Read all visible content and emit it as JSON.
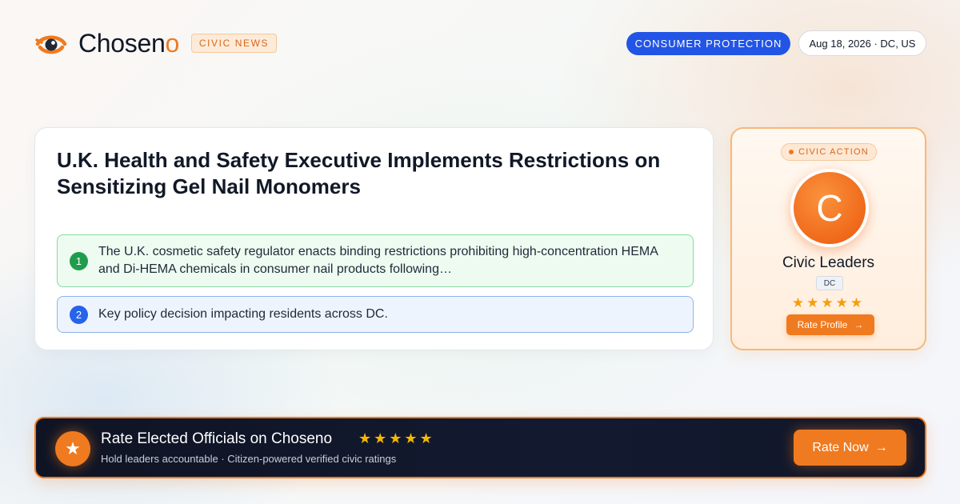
{
  "brand": {
    "name_main": "Chosen",
    "name_accent": "o",
    "accent_color": "#f07a1f"
  },
  "header": {
    "tag": "CIVIC NEWS",
    "category": "CONSUMER PROTECTION",
    "date_location": "Aug 18, 2026 · DC, US"
  },
  "article": {
    "headline": "U.K. Health and Safety Executive Implements Restrictions on Sensitizing Gel Nail Monomers",
    "points": [
      {
        "number": "1",
        "text": "The U.K. cosmetic safety regulator enacts binding restrictions prohibiting high-concentration HEMA and Di-HEMA chemicals in consumer nail products following…"
      },
      {
        "number": "2",
        "text": "Key policy decision impacting residents across DC."
      }
    ]
  },
  "civic_action": {
    "tag": "CIVIC ACTION",
    "avatar_initial": "C",
    "name": "Civic Leaders",
    "state": "DC",
    "stars": "★★★★★",
    "button_label": "Rate Profile",
    "button_arrow": "→"
  },
  "banner": {
    "icon": "★",
    "title": "Rate Elected Officials on Choseno",
    "stars": "★★★★★",
    "subtitle": "Hold leaders accountable · Citizen-powered verified civic ratings",
    "button_label": "Rate Now",
    "button_arrow": "→"
  },
  "icons": {
    "logo": "eye-logo-icon",
    "banner_badge": "star-icon",
    "arrow": "arrow-right-icon"
  }
}
